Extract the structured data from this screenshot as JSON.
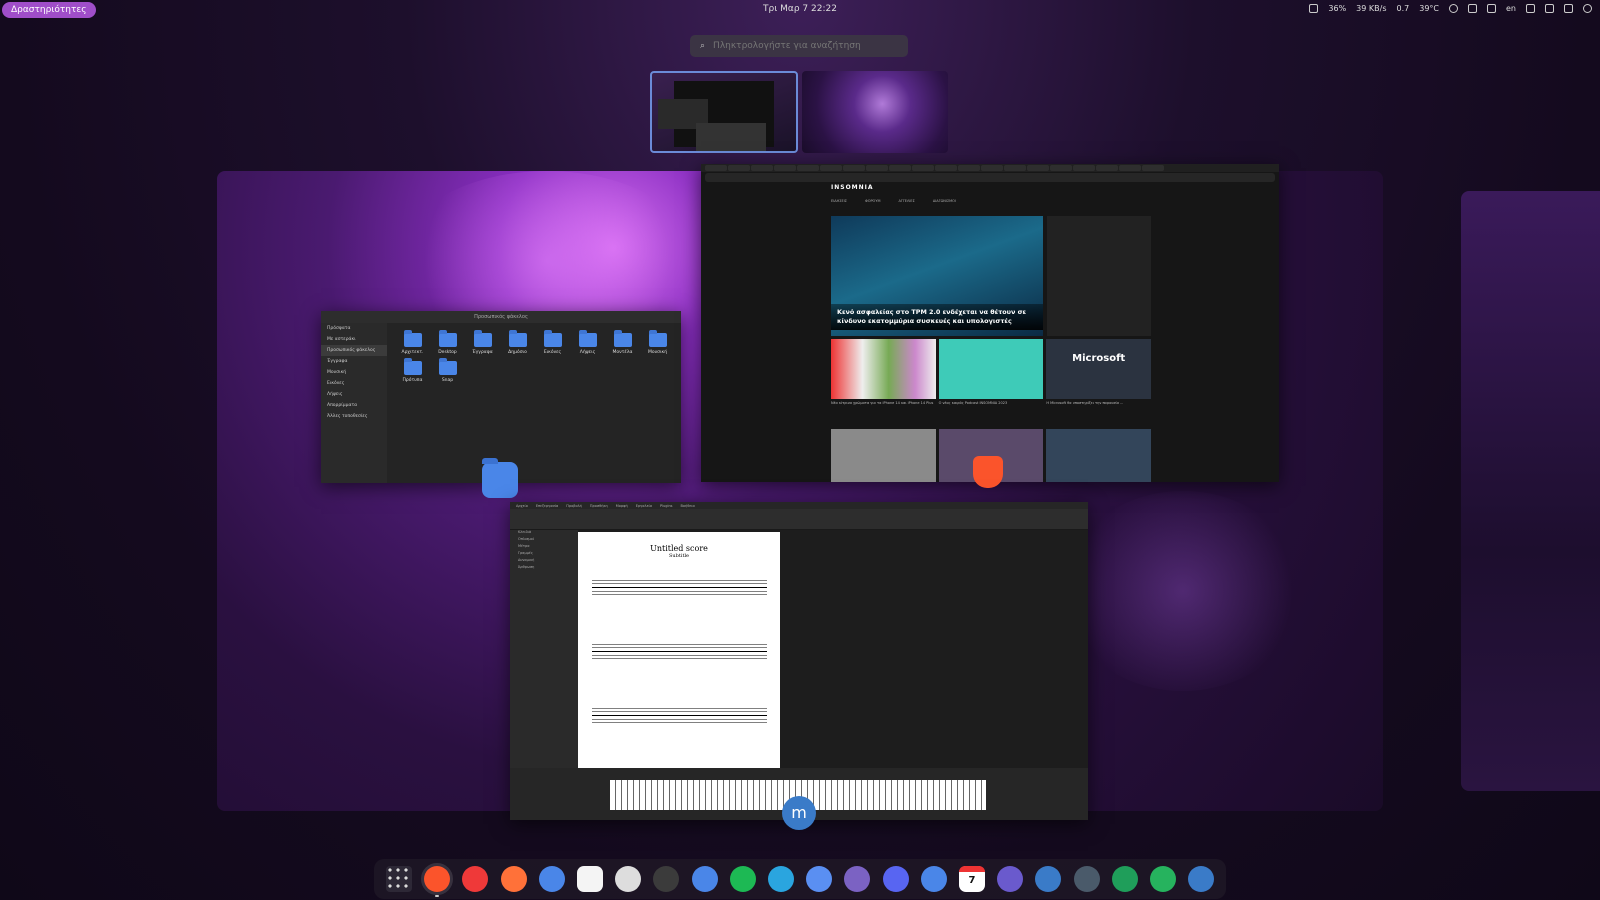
{
  "topbar": {
    "activities": "Δραστηριότητες",
    "clock": "Τρι Μαρ 7  22:22",
    "tray": {
      "battery": "36%",
      "network": "39 KB/s",
      "load": "0.7",
      "temp": "39°C",
      "lang": "en"
    }
  },
  "search": {
    "placeholder": "Πληκτρολογήστε για αναζήτηση"
  },
  "filemanager": {
    "title": "Προσωπικός φάκελος",
    "sidebar": [
      "Πρόσφατα",
      "Με αστεράκι",
      "Προσωπικός φάκελος",
      "Έγγραφα",
      "Μουσική",
      "Εικόνες",
      "Λήψεις",
      "Απορρίμματα",
      "Άλλες τοποθεσίες"
    ],
    "folders": [
      "Αρχιτεκτ.",
      "Desktop",
      "Έγγραφα",
      "Δημόσιο",
      "Εικόνες",
      "Λήψεις",
      "Μοντέλα",
      "Μουσική",
      "Πρότυπα",
      "Snap"
    ]
  },
  "browser": {
    "site_logo": "INSOMNIA",
    "nav": [
      "ΕΙΔΗΣΕΙΣ",
      "ΦΟΡΟΥΜ",
      "ΑΓΓΕΛΙΕΣ",
      "ΔΙΑΓΩΝΙΣΜΟΙ"
    ],
    "headline": "Κενό ασφαλείας στο TPM 2.0 ενδέχεται να θέτουν σε κίνδυνο εκατομμύρια συσκευές και υπολογιστές",
    "thumb3_label": "Microsoft",
    "captions": [
      "Νέα κίτρινα χρώματα για τα iPhone 14 και iPhone 14 Plus",
      "Ο νέος καιρός Podcast INSOMNIA 2023",
      "Η Microsoft θα υποστηρίξει την παρουσία ..."
    ]
  },
  "musescore": {
    "score_title": "Untitled score",
    "score_subtitle": "Subtitle",
    "menu": [
      "Αρχείο",
      "Επεξεργασία",
      "Προβολή",
      "Προσθήκη",
      "Μορφή",
      "Εργαλεία",
      "Plugins",
      "Βοήθεια"
    ],
    "panel": [
      "Κλειδιά",
      "Οπλισμοί",
      "Μέτρα",
      "Γραμμές",
      "Δυναμική",
      "Άρθρωση"
    ]
  },
  "dock": {
    "apps": [
      {
        "name": "app-grid-icon",
        "color": "#2d2836"
      },
      {
        "name": "brave-icon",
        "color": "#fb542b",
        "selected": true
      },
      {
        "name": "vivaldi-icon",
        "color": "#ef3939"
      },
      {
        "name": "firefox-icon",
        "color": "#ff7139"
      },
      {
        "name": "files-icon",
        "color": "#4a86e8"
      },
      {
        "name": "text-editor-icon",
        "color": "#f4f4f4"
      },
      {
        "name": "gimp-icon",
        "color": "#dddddd"
      },
      {
        "name": "terminal-icon",
        "color": "#3b3b3b"
      },
      {
        "name": "bookmark-icon",
        "color": "#4a86e8"
      },
      {
        "name": "spotify-icon",
        "color": "#1db954"
      },
      {
        "name": "telegram-icon",
        "color": "#2aa5df"
      },
      {
        "name": "messenger-icon",
        "color": "#5a8ff2"
      },
      {
        "name": "viber-icon",
        "color": "#7b62c3"
      },
      {
        "name": "discord-icon",
        "color": "#5865f2"
      },
      {
        "name": "mail-icon",
        "color": "#4a86e8"
      },
      {
        "name": "calendar-icon",
        "color": "#ffffff",
        "text": "7"
      },
      {
        "name": "grammar-icon",
        "color": "#6a5acd"
      },
      {
        "name": "musescore-icon",
        "color": "#3a7bc8"
      },
      {
        "name": "translate-icon",
        "color": "#4a5a6a"
      },
      {
        "name": "headset-icon",
        "color": "#1f9e5a"
      },
      {
        "name": "vpn-icon",
        "color": "#26b35e"
      },
      {
        "name": "toggle-icon",
        "color": "#3a7bc8"
      }
    ]
  }
}
